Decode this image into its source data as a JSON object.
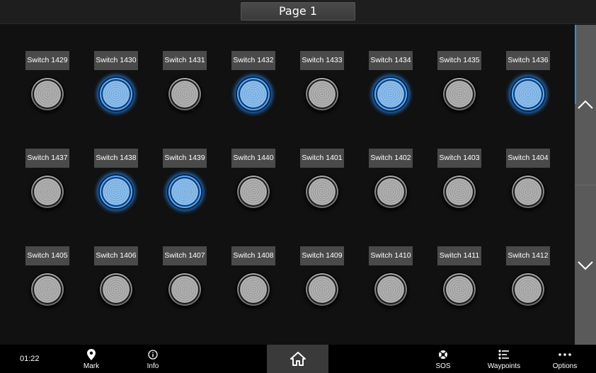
{
  "header": {
    "title": "Page 1"
  },
  "switches": [
    {
      "label": "Switch 1429",
      "on": false
    },
    {
      "label": "Switch 1430",
      "on": true
    },
    {
      "label": "Switch 1431",
      "on": false
    },
    {
      "label": "Switch 1432",
      "on": true
    },
    {
      "label": "Switch 1433",
      "on": false
    },
    {
      "label": "Switch 1434",
      "on": true
    },
    {
      "label": "Switch 1435",
      "on": false
    },
    {
      "label": "Switch 1436",
      "on": true
    },
    {
      "label": "Switch 1437",
      "on": false
    },
    {
      "label": "Switch 1438",
      "on": true
    },
    {
      "label": "Switch 1439",
      "on": true
    },
    {
      "label": "Switch 1440",
      "on": false
    },
    {
      "label": "Switch 1401",
      "on": false
    },
    {
      "label": "Switch 1402",
      "on": false
    },
    {
      "label": "Switch 1403",
      "on": false
    },
    {
      "label": "Switch 1404",
      "on": false
    },
    {
      "label": "Switch 1405",
      "on": false
    },
    {
      "label": "Switch 1406",
      "on": false
    },
    {
      "label": "Switch 1407",
      "on": false
    },
    {
      "label": "Switch 1408",
      "on": false
    },
    {
      "label": "Switch 1409",
      "on": false
    },
    {
      "label": "Switch 1410",
      "on": false
    },
    {
      "label": "Switch 1411",
      "on": false
    },
    {
      "label": "Switch 1412",
      "on": false
    }
  ],
  "scroll": {
    "up_icon": "chevron-up-icon",
    "down_icon": "chevron-down-icon"
  },
  "footer": {
    "clock": "01:22",
    "buttons": [
      {
        "label": "Mark",
        "icon": "map-pin-icon"
      },
      {
        "label": "Info",
        "icon": "info-icon"
      },
      {
        "label": "",
        "icon": "home-icon"
      },
      {
        "label": "SOS",
        "icon": "sos-icon"
      },
      {
        "label": "Waypoints",
        "icon": "waypoints-icon"
      },
      {
        "label": "Options",
        "icon": "more-icon"
      }
    ]
  },
  "colors": {
    "accent": "#2a8fff",
    "background": "#111111",
    "label_bg": "#4a4a4a"
  }
}
